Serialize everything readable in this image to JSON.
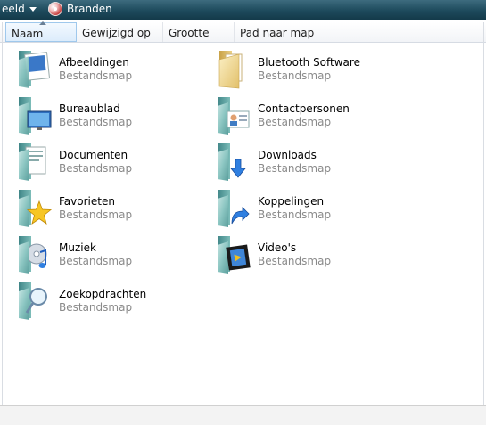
{
  "toolbar": {
    "left_fragment": "eeld",
    "burn_label": "Branden"
  },
  "columns": [
    "Naam",
    "Gewijzigd op",
    "Grootte",
    "Pad naar map"
  ],
  "items": [
    {
      "name": "Afbeeldingen",
      "type": "Bestandsmap",
      "icon": "pictures-folder-icon"
    },
    {
      "name": "Bluetooth Software",
      "type": "Bestandsmap",
      "icon": "folder-icon"
    },
    {
      "name": "Bureaublad",
      "type": "Bestandsmap",
      "icon": "desktop-folder-icon"
    },
    {
      "name": "Contactpersonen",
      "type": "Bestandsmap",
      "icon": "contacts-folder-icon"
    },
    {
      "name": "Documenten",
      "type": "Bestandsmap",
      "icon": "documents-folder-icon"
    },
    {
      "name": "Downloads",
      "type": "Bestandsmap",
      "icon": "downloads-folder-icon"
    },
    {
      "name": "Favorieten",
      "type": "Bestandsmap",
      "icon": "favorites-folder-icon"
    },
    {
      "name": "Koppelingen",
      "type": "Bestandsmap",
      "icon": "links-folder-icon"
    },
    {
      "name": "Muziek",
      "type": "Bestandsmap",
      "icon": "music-folder-icon"
    },
    {
      "name": "Video's",
      "type": "Bestandsmap",
      "icon": "videos-folder-icon"
    },
    {
      "name": "Zoekopdrachten",
      "type": "Bestandsmap",
      "icon": "searches-folder-icon"
    }
  ],
  "colors": {
    "toolbar_bg": "#1d4a5c",
    "folder_teal": "#5fa0a0",
    "secondary_text": "#8a8a8a"
  }
}
